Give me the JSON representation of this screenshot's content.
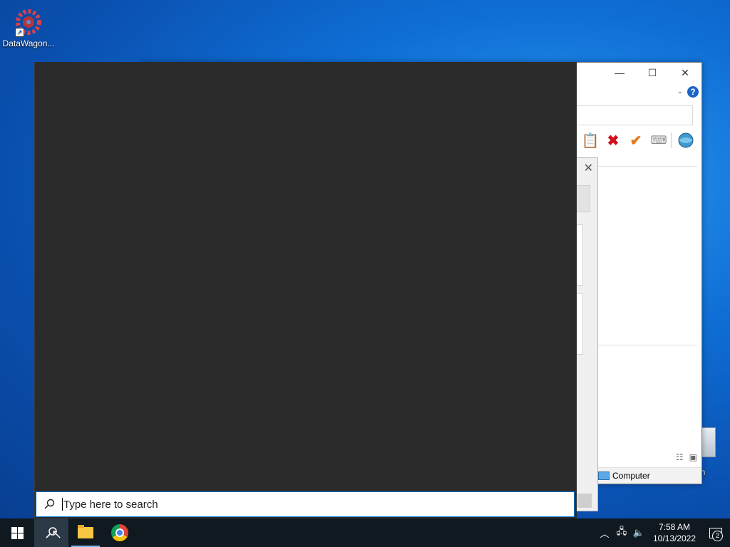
{
  "desktop": {
    "icons": [
      {
        "label": "DataWagon..."
      },
      {
        "label": "e Bin"
      }
    ]
  },
  "background_window": {
    "title_buttons": {
      "minimize": "—",
      "maximize": "☐",
      "close": "✕"
    },
    "help": "?",
    "status_location": "Computer"
  },
  "search": {
    "placeholder": "Type here to search",
    "value": ""
  },
  "taskbar": {
    "clock_time": "7:58 AM",
    "clock_date": "10/13/2022",
    "notification_count": "2"
  },
  "colors": {
    "taskbar": "#101820",
    "flyout": "#2b2b2b",
    "accent": "#0078d7"
  }
}
